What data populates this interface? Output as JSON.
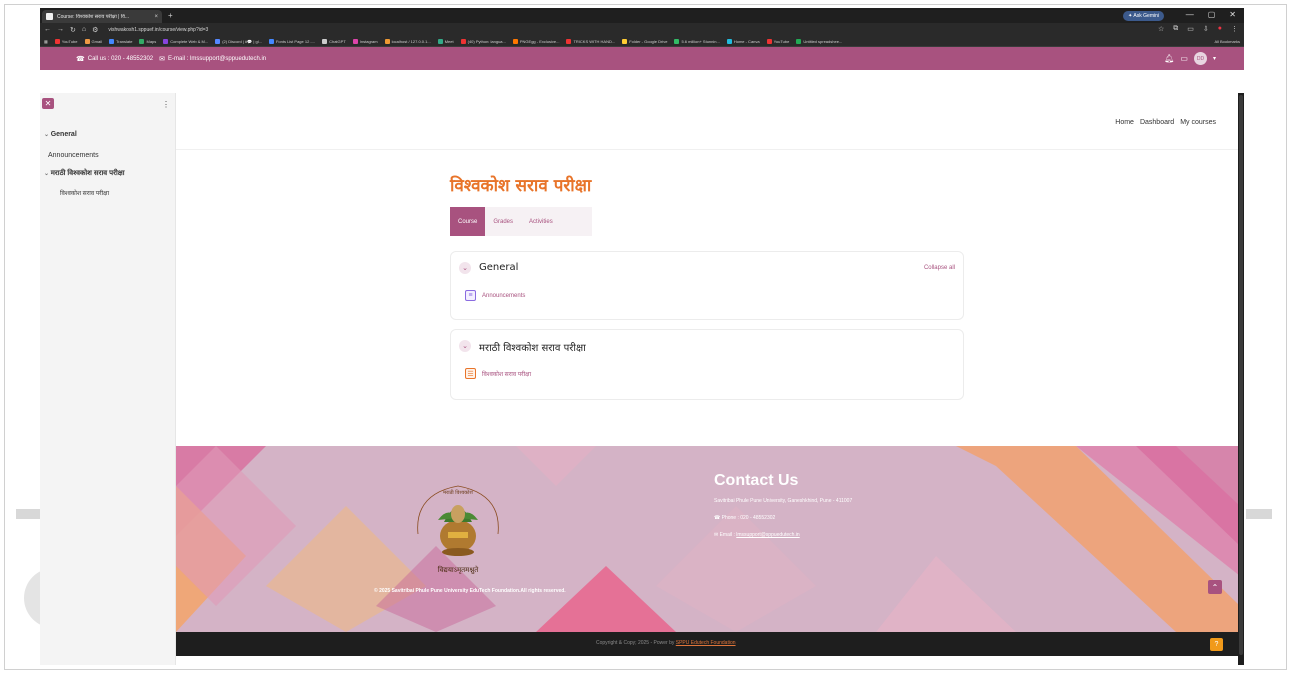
{
  "browser": {
    "tab_title": "Course: विश्वकोश सराव परीक्षा | वि...",
    "new_tab": "+",
    "tab_close": "×",
    "ask_gemini": "✦ Ask Gemini",
    "window_controls": [
      "—",
      "▢",
      "✕"
    ],
    "url": "vishwakosh1.sppuef.in/course/view.php?id=3",
    "bookmarks": [
      {
        "label": "YouTube",
        "color": "#e33"
      },
      {
        "label": "Gmail",
        "color": "#e94"
      },
      {
        "label": "Translate",
        "color": "#48f"
      },
      {
        "label": "Maps",
        "color": "#3a6"
      },
      {
        "label": "Complete Web & M...",
        "color": "#84d"
      },
      {
        "label": "(2) Discord | #💬 | gl...",
        "color": "#58f"
      },
      {
        "label": "Fonts List Page 12 -...",
        "color": "#48f"
      },
      {
        "label": "ChatGPT",
        "color": "#ccc"
      },
      {
        "label": "Instagram",
        "color": "#d4a"
      },
      {
        "label": "localhost / 127.0.0.1...",
        "color": "#e93"
      },
      {
        "label": "Meet",
        "color": "#3a8"
      },
      {
        "label": "(40) Python: langua...",
        "color": "#e33"
      },
      {
        "label": "PNGEgg - Exclusive...",
        "color": "#f70"
      },
      {
        "label": "TRICKS WITH HAND...",
        "color": "#e33"
      },
      {
        "label": "Folder - Google Drive",
        "color": "#fc3"
      },
      {
        "label": "5.6 million+ Stunnin...",
        "color": "#3b6"
      },
      {
        "label": "Home - Canva",
        "color": "#2bd"
      },
      {
        "label": "YouTube",
        "color": "#e33"
      },
      {
        "label": "Untitled spreadshee...",
        "color": "#2a5"
      }
    ],
    "all_bookmarks": "All Bookmarks"
  },
  "topbar": {
    "call": "Call us : 020 - 48552302",
    "email": "E-mail : lmssupport@sppuedutech.in",
    "avatar_initials": "DD"
  },
  "sidebar": {
    "general": "General",
    "announcements": "Announcements",
    "section2": "मराठी विश्वकोश सराव परीक्षा",
    "quiz": "विश्वकोश सराव परीक्षा"
  },
  "header_nav": [
    "Home",
    "Dashboard",
    "My courses"
  ],
  "course": {
    "title": "विश्वकोश सराव परीक्षा",
    "tabs": [
      "Course",
      "Grades",
      "Activities"
    ],
    "collapse_all": "Collapse all",
    "sections": [
      {
        "title": "General",
        "activity": "Announcements"
      },
      {
        "title": "मराठी विश्वकोश सराव परीक्षा",
        "activity": "विश्वकोश सराव परीक्षा"
      }
    ]
  },
  "footer": {
    "copyright": "© 2025 Savitribai Phule Pune University EduTech Foundation.All rights reserved.",
    "contact_title": "Contact Us",
    "address": "Savitribai Phule Pune University, Ganeshkhind, Pune - 411007",
    "phone": "Phone : 020 - 48552302",
    "email_label": "Email : ",
    "email_link": "lmssupport@sppuedutech.in",
    "logo_motto": "विद्ययाऽमृतमश्नुते",
    "logo_top": "महाराष्ट्र राज्य मराठी विश्वकोश निर्मिती मंडळ"
  },
  "bottombar": {
    "text": "Copyright & Copy; 2025 - Power by ",
    "link": "SPPU Edutech Foundation"
  },
  "colors": {
    "primary": "#a8527f",
    "title_orange": "#e8742a",
    "footer_bg": "#d4b3c6",
    "help_orange": "#f19a1a"
  }
}
